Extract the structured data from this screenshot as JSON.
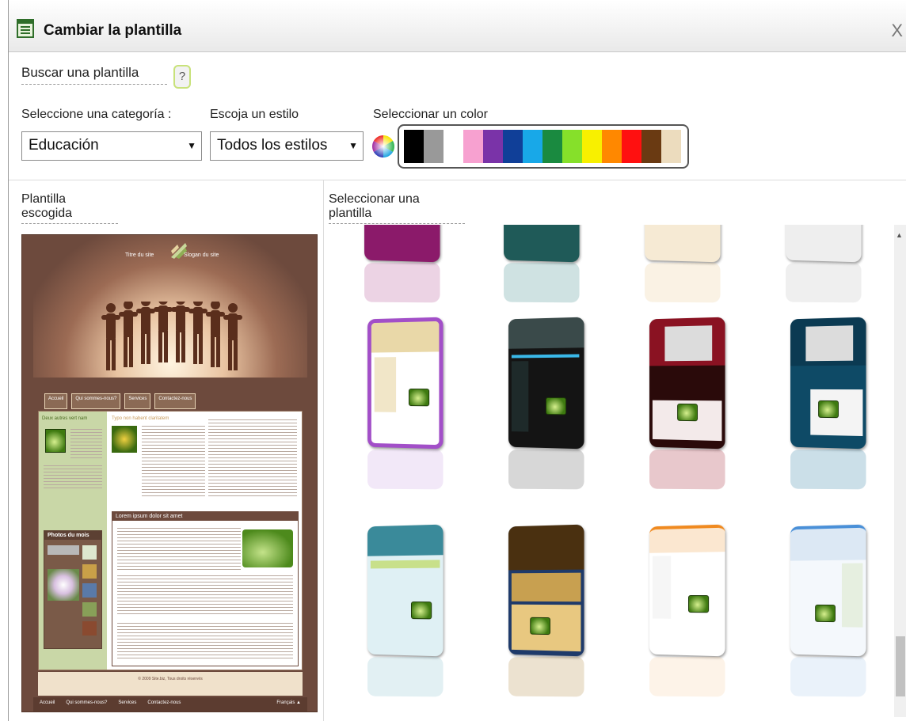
{
  "window": {
    "title": "Cambiar la plantilla",
    "close_label": "X"
  },
  "search": {
    "header": "Buscar una plantilla",
    "help_label": "?"
  },
  "filters": {
    "category_label": "Seleccione una categoría :",
    "category_value": "Educación",
    "style_label": "Escoja un estilo",
    "style_value": "Todos los estilos",
    "color_label": "Seleccionar un color",
    "colors": [
      "#000000",
      "#999999",
      "#ffffff",
      "#f7a1d0",
      "#7a33a8",
      "#103f98",
      "#18a8e8",
      "#1a8a40",
      "#86e02a",
      "#f8f000",
      "#ff8800",
      "#ff1010",
      "#6a3a12",
      "#ecdcbe"
    ]
  },
  "chosen": {
    "header": "Plantilla escogida",
    "preview": {
      "site_title": "Titre du site",
      "slogan": "Slogan du site",
      "nav": [
        "Accueil",
        "Qui sommes-nous?",
        "Services",
        "Contactez-nous"
      ],
      "side_title": "Deux autres vert nam",
      "main_title": "Typo non habent claritatem",
      "box_title": "Lorem ipsum dolor sit amet",
      "photos_title": "Photos du mois",
      "footer_copy": "© 2009 Site.biz, Tous droits réservés",
      "bottom_nav": [
        "Accueil",
        "Qui sommes-nous?",
        "Services",
        "Contactez-nous"
      ],
      "language": "Français ▲"
    }
  },
  "gallery": {
    "header": "Seleccionar una plantilla",
    "templates_shown": 12
  }
}
